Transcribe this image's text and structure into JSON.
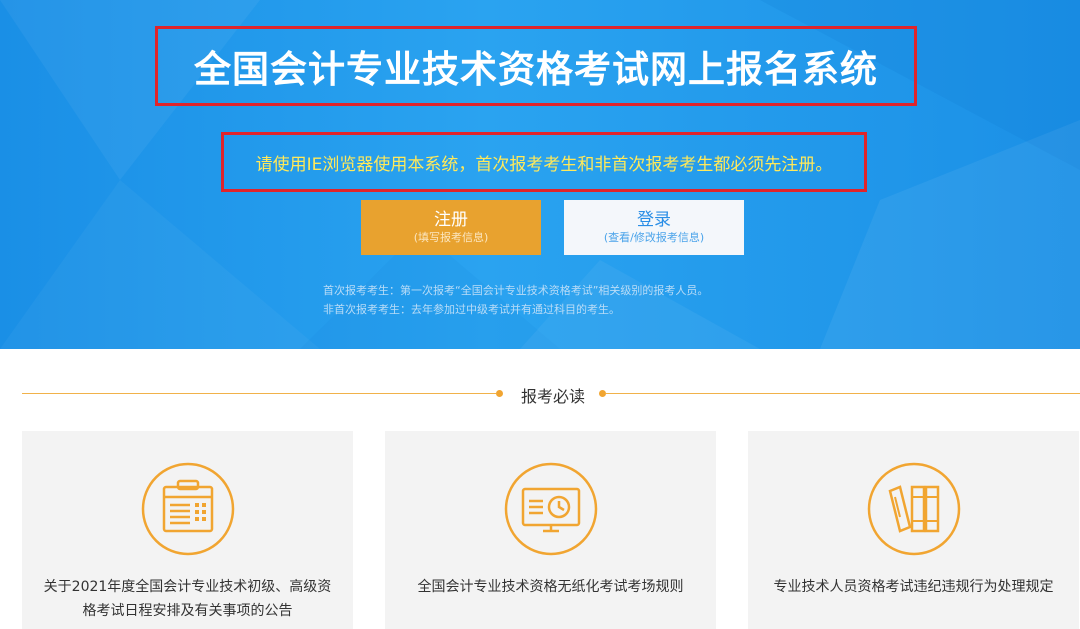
{
  "header": {
    "title": "全国会计专业技术资格考试网上报名系统",
    "notice": "请使用IE浏览器使用本系统，首次报考考生和非首次报考考生都必须先注册。",
    "buttons": {
      "register": {
        "label": "注册",
        "sub": "(填写报考信息)"
      },
      "login": {
        "label": "登录",
        "sub": "(查看/修改报考信息)"
      }
    },
    "hints": [
      "首次报考考生：第一次报考“全国会计专业技术资格考试”相关级别的报考人员。",
      "非首次报考考生：去年参加过中级考试并有通过科目的考生。"
    ]
  },
  "section": {
    "title": "报考必读"
  },
  "cards": [
    {
      "text": "关于2021年度全国会计专业技术初级、高级资格考试日程安排及有关事项的公告",
      "icon": "calendar-document-icon"
    },
    {
      "text": "全国会计专业技术资格无纸化考试考场规则",
      "icon": "computer-clock-icon"
    },
    {
      "text": "专业技术人员资格考试违纪违规行为处理规定",
      "icon": "books-icon"
    }
  ],
  "colors": {
    "hero_blue": "#1a8fe6",
    "highlight_red": "#e0242b",
    "notice_yellow": "#ffe95a",
    "accent_orange": "#e8a22f",
    "icon_orange": "#f1a531"
  }
}
